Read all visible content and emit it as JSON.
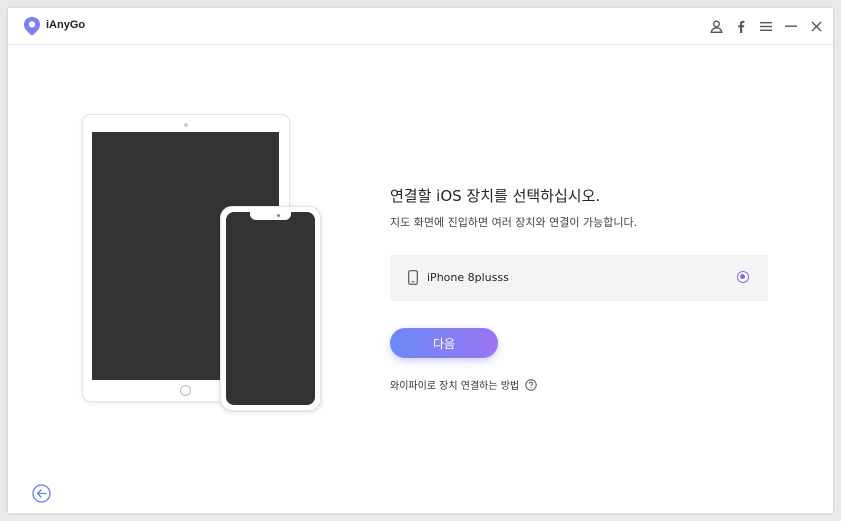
{
  "window": {
    "title": "iAnyGo",
    "controls": {
      "account": "user-icon",
      "facebook": "facebook-icon",
      "menu": "menu-icon",
      "minimize": "minimize-icon",
      "close": "close-icon"
    }
  },
  "main": {
    "heading": "연결할 iOS 장치를 선택하십시오.",
    "subheading": "지도 화면에 진입하면 여러 장치와 연결이 가능합니다.",
    "devices": [
      {
        "name": "iPhone 8plusss",
        "selected": true,
        "icon": "phone-icon"
      }
    ],
    "next_label": "다음",
    "wifi_help_label": "와이파이로 장치 연결하는 방법"
  },
  "colors": {
    "accent": "#7b6cf0",
    "button_gradient_start": "#6a8af5",
    "button_gradient_end": "#9b74f4",
    "device_screen": "#333333"
  }
}
